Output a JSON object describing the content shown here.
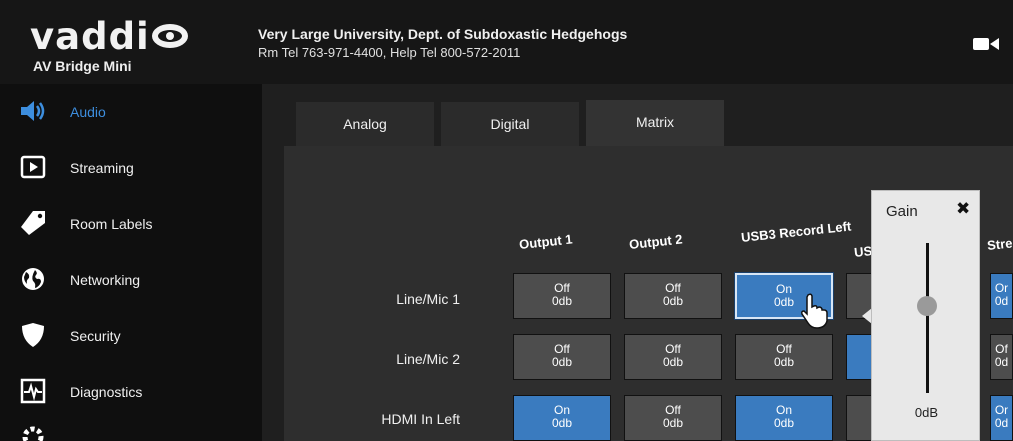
{
  "header": {
    "brand": "vaddi",
    "product": "AV Bridge Mini",
    "org_name": "Very Large University, Dept. of Subdoxastic Hedgehogs",
    "org_phones": "Rm Tel 763-971-4400, Help Tel 800-572-2011"
  },
  "sidebar": {
    "items": [
      {
        "label": "Audio",
        "icon": "speaker-icon",
        "active": true
      },
      {
        "label": "Streaming",
        "icon": "play-icon"
      },
      {
        "label": "Room Labels",
        "icon": "tag-icon"
      },
      {
        "label": "Networking",
        "icon": "globe-icon"
      },
      {
        "label": "Security",
        "icon": "shield-icon"
      },
      {
        "label": "Diagnostics",
        "icon": "pulse-icon"
      }
    ]
  },
  "tabs": [
    {
      "label": "Analog"
    },
    {
      "label": "Digital"
    },
    {
      "label": "Matrix",
      "active": true
    }
  ],
  "matrix": {
    "columns": [
      "Output 1",
      "Output 2",
      "USB3 Record Left",
      "US",
      "Stre"
    ],
    "rows": [
      {
        "label": "Line/Mic 1",
        "cells": [
          {
            "state": "Off",
            "gain": "0db"
          },
          {
            "state": "Off",
            "gain": "0db"
          },
          {
            "state": "On",
            "gain": "0db"
          }
        ]
      },
      {
        "label": "Line/Mic 2",
        "cells": [
          {
            "state": "Off",
            "gain": "0db"
          },
          {
            "state": "Off",
            "gain": "0db"
          },
          {
            "state": "Off",
            "gain": "0db"
          }
        ]
      },
      {
        "label": "HDMI In Left",
        "cells": [
          {
            "state": "On",
            "gain": "0db"
          },
          {
            "state": "Off",
            "gain": "0db"
          },
          {
            "state": "On",
            "gain": "0db"
          }
        ]
      }
    ],
    "partial": {
      "on": "Or",
      "on_gain": "0d",
      "off": "Of",
      "off_gain": "0d"
    }
  },
  "gain_popup": {
    "title": "Gain",
    "close": "✖",
    "value": "0dB",
    "level": 0.58
  },
  "colors": {
    "accent": "#3d8ede",
    "cell_on": "#3a7bbf",
    "cell_off": "#4d4d4d"
  }
}
